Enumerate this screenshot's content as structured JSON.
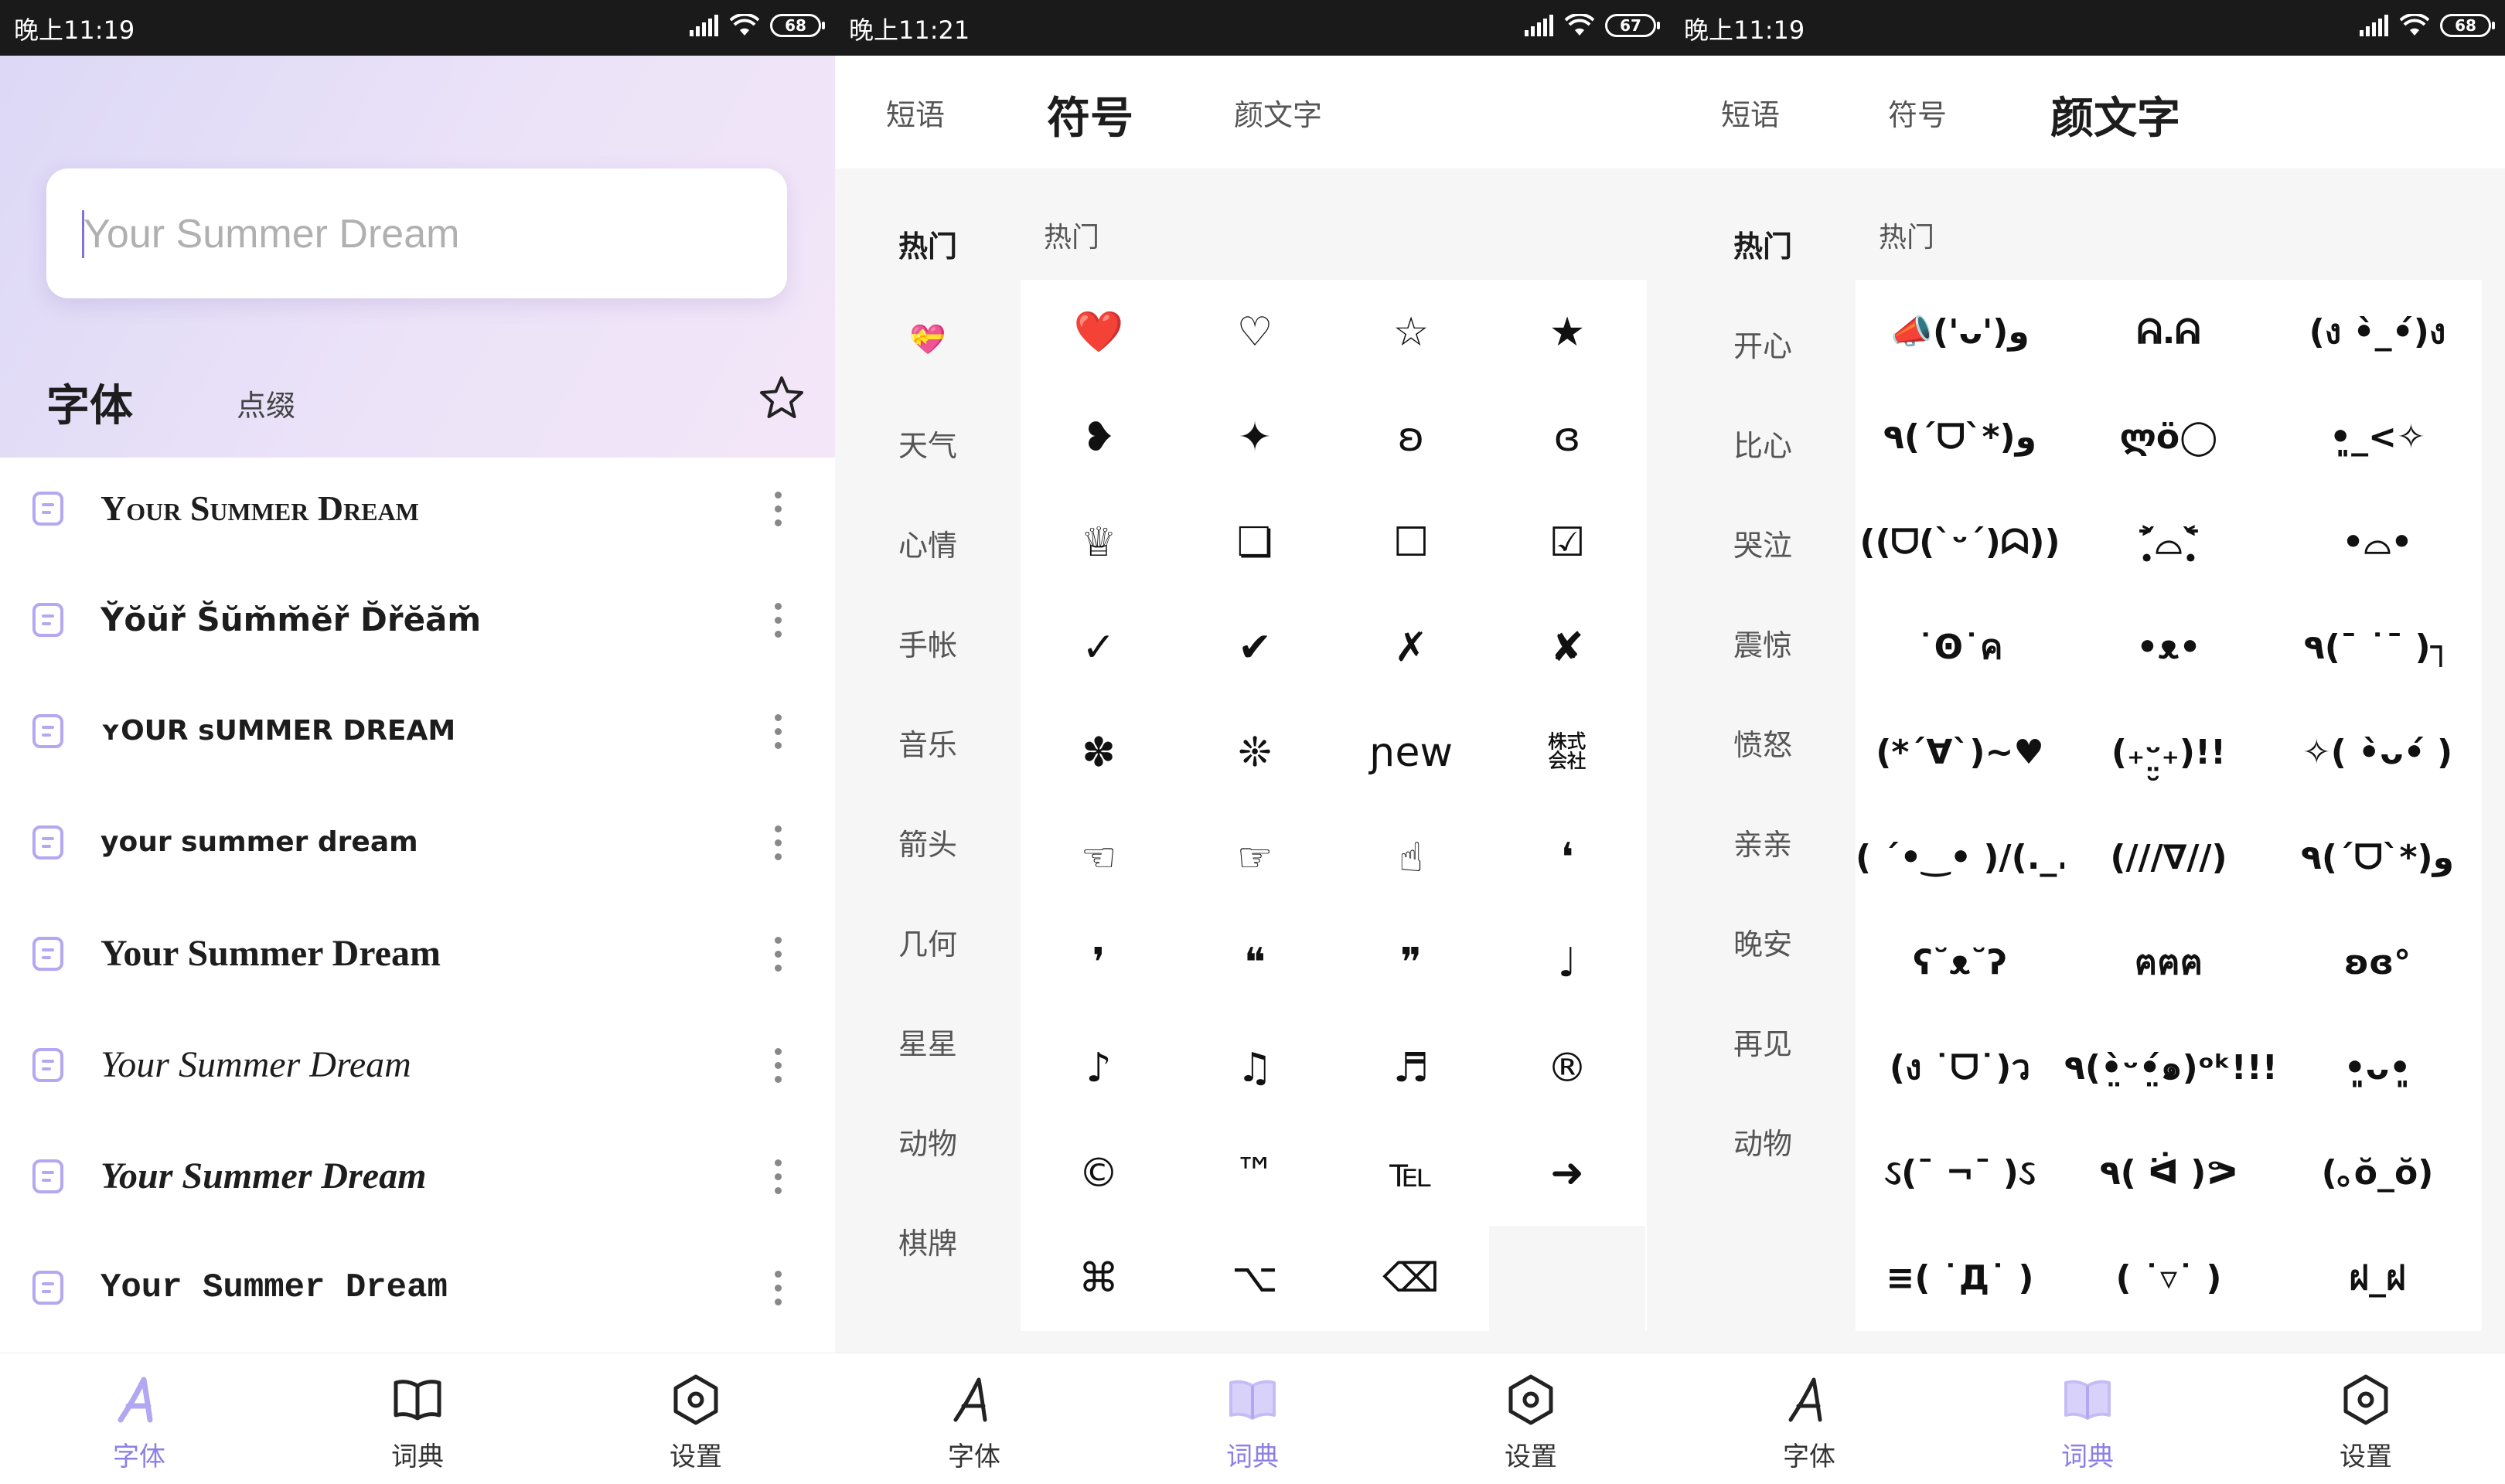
{
  "status_bars": [
    {
      "time": "晚上11:19",
      "battery": "68"
    },
    {
      "time": "晚上11:21",
      "battery": "67"
    },
    {
      "time": "晚上11:19",
      "battery": "68"
    }
  ],
  "screen1": {
    "search_placeholder": "Your Summer Dream",
    "tabs": {
      "active": "字体",
      "inactive": "点缀"
    },
    "font_rows": [
      "Your Summer Dream",
      "Y̆ŏŭř S̆ŭm̆m̆ĕř D̆řĕăm̆",
      "ʏOUR sUMMER DREAM",
      "your summer dream",
      "Your Summer Dream",
      "Your Summer Dream",
      "Your Summer Dream",
      "Your Summer Dream"
    ]
  },
  "bottom_nav": [
    {
      "label": "字体",
      "icon": "font-icon"
    },
    {
      "label": "词典",
      "icon": "book-icon"
    },
    {
      "label": "设置",
      "icon": "settings-hexagon-icon"
    }
  ],
  "dict_tabs": [
    "短语",
    "符号",
    "颜文字"
  ],
  "screen2": {
    "section_title": "热门",
    "categories": [
      "热门",
      "💝",
      "天气",
      "心情",
      "手帐",
      "音乐",
      "箭头",
      "几何",
      "星星",
      "动物",
      "棋牌"
    ],
    "symbols": [
      "❤️",
      "♡",
      "☆",
      "★",
      "❥",
      "✦",
      "ʚ",
      "ɞ",
      "♕",
      "❏",
      "☐",
      "☑",
      "✓",
      "✔",
      "✗",
      "✘",
      "✽",
      "❊",
      "ɲew",
      "㍿",
      "☜",
      "☞",
      "☝",
      "❛",
      "❜",
      "❝",
      "❞",
      "♩",
      "♪",
      "♫",
      "♬",
      "®",
      "©",
      "™",
      "℡",
      "➜",
      "⌘",
      "⌥",
      "⌫"
    ]
  },
  "screen3": {
    "section_title": "热门",
    "categories": [
      "热门",
      "开心",
      "比心",
      "哭泣",
      "震惊",
      "愤怒",
      "亲亲",
      "晚安",
      "再见",
      "动物"
    ],
    "kaomoji": [
      "📣('ᴗ')و",
      "ᕱ.ᕱ",
      "(ง •̀_•́)ง",
      "٩(´ᗜ`*)و",
      "ლö◯",
      "•͈_<✧",
      "((ᗜ(`ᵕ´)ᗣ))",
      "˃̣̣̥᷄⌓˂̣̣̥᷅",
      "•⌓•",
      "˙Ꙩ˙ค",
      "•ᴥ•",
      "٩(¯ ˙¯ )┐",
      "(*´∀`)~♥",
      "(₊ᵕ̤̮₊)!!",
      "✧( •̀ᴗ•́ )",
      "( ´•‿• )/(._.`)",
      "(///∇//)",
      "٩(ˊᗜˋ*)و",
      "ʕ˘ᴥ˘ʔ",
      "ฅฅฅ",
      "ʚɞ°",
      "(ง ˙ᗜ˙)ว",
      "٩(•̤̀ᵕ•̤́๑)ᵒᵏ!!!!",
      "•͈ᴗ•͈",
      "ઽ(¯ ¬¯ )ઽ",
      "٩( ᐛ )ᕗ",
      "(｡ŏ_ŏ)",
      "≡( ˙Д˙ )",
      "( ˙▿˙ )",
      "ฝ_ฝ"
    ]
  }
}
